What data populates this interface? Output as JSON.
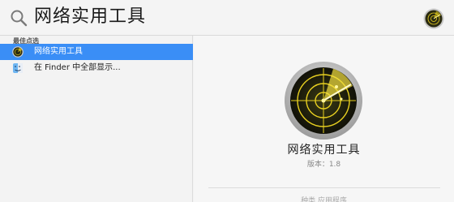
{
  "search": {
    "query": "网络实用工具",
    "icon": "search-icon",
    "app_icon": "radar-app-icon"
  },
  "results": {
    "section_header": "最佳点选",
    "items": [
      {
        "label": "网络实用工具",
        "icon": "radar-app-icon",
        "selected": true
      },
      {
        "label": "在 Finder 中全部显示...",
        "icon": "finder-icon",
        "selected": false
      }
    ]
  },
  "preview": {
    "title": "网络实用工具",
    "version": "版本：1.8",
    "footer": "种类   应用程序"
  },
  "colors": {
    "selection": "#3a8ef6",
    "radar_green": "#e8d020"
  }
}
